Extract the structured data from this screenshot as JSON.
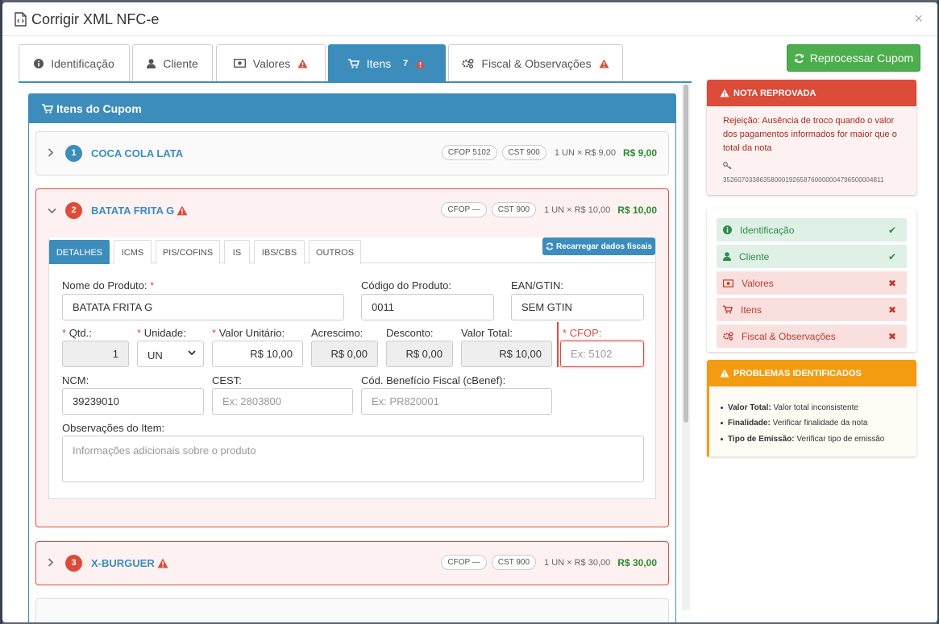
{
  "modal": {
    "title": "Corrigir XML NFC-e",
    "close": "×"
  },
  "tabs": [
    {
      "label": "Identificação",
      "icon": "info-circle-icon",
      "warning": false,
      "active": false
    },
    {
      "label": "Cliente",
      "icon": "user-icon",
      "warning": false,
      "active": false
    },
    {
      "label": "Valores",
      "icon": "money-icon",
      "warning": true,
      "active": false
    },
    {
      "label": "Itens",
      "icon": "cart-icon",
      "badge": "7",
      "warning": true,
      "active": true
    },
    {
      "label": "Fiscal & Observações",
      "icon": "cogs-icon",
      "warning": true,
      "active": false
    }
  ],
  "reprocess_button": "Reprocessar Cupom",
  "items_panel": {
    "title": "Itens do Cupom",
    "items": [
      {
        "num": "1",
        "name": "COCA COLA LATA",
        "cfop": "CFOP 5102",
        "cst": "CST 900",
        "qty": "1 UN × R$ 9,00",
        "total": "R$ 9,00",
        "error": false,
        "expanded": false
      },
      {
        "num": "2",
        "name": "BATATA FRITA G",
        "cfop": "CFOP —",
        "cst": "CST 900",
        "qty": "1 UN × R$ 10,00",
        "total": "R$ 10,00",
        "error": true,
        "expanded": true
      },
      {
        "num": "3",
        "name": "X-BURGUER",
        "cfop": "CFOP —",
        "cst": "CST 900",
        "qty": "1 UN × R$ 30,00",
        "total": "R$ 30,00",
        "error": true,
        "expanded": false
      }
    ]
  },
  "detail": {
    "tabs": [
      "DETALHES",
      "ICMS",
      "PIS/COFINS",
      "IS",
      "IBS/CBS",
      "OUTROS"
    ],
    "reload_button": "Recarregar dados fiscais",
    "fields": {
      "nome_label": "Nome do Produto:",
      "nome_value": "BATATA FRITA G",
      "codigo_label": "Código do Produto:",
      "codigo_value": "0011",
      "ean_label": "EAN/GTIN:",
      "ean_value": "SEM GTIN",
      "qtd_label": "Qtd.:",
      "qtd_value": "1",
      "unidade_label": "Unidade:",
      "unidade_value": "UN",
      "valor_unit_label": "Valor Unitário:",
      "valor_unit_value": "R$ 10,00",
      "acrescimo_label": "Acrescimo:",
      "acrescimo_value": "R$ 0,00",
      "desconto_label": "Desconto:",
      "desconto_value": "R$ 0,00",
      "valor_total_label": "Valor Total:",
      "valor_total_value": "R$ 10,00",
      "cfop_label": "CFOP:",
      "cfop_placeholder": "Ex: 5102",
      "ncm_label": "NCM:",
      "ncm_value": "39239010",
      "cest_label": "CEST:",
      "cest_placeholder": "Ex: 2803800",
      "cbenef_label": "Cód. Benefício Fiscal (cBenef):",
      "cbenef_placeholder": "Ex: PR820001",
      "obs_label": "Observações do Item:",
      "obs_placeholder": "Informações adicionais sobre o produto",
      "required_mark": "*"
    }
  },
  "nota_reprovada": {
    "title": "NOTA REPROVADA",
    "rejeicao": "Rejeição: Ausência de troco quando o valor dos pagamentos informados for maior que o total da nota",
    "chave": "35260703386358000192658760000004796500004811"
  },
  "status_list": [
    {
      "label": "Identificação",
      "ok": true,
      "icon": "info-circle-icon",
      "mark": "✔"
    },
    {
      "label": "Cliente",
      "ok": true,
      "icon": "user-icon",
      "mark": "✔"
    },
    {
      "label": "Valores",
      "ok": false,
      "icon": "money-icon",
      "mark": "✖"
    },
    {
      "label": "Itens",
      "ok": false,
      "icon": "cart-icon",
      "mark": "✖"
    },
    {
      "label": "Fiscal & Observações",
      "ok": false,
      "icon": "cogs-icon",
      "mark": "✖"
    }
  ],
  "problemas": {
    "title": "PROBLEMAS IDENTIFICADOS",
    "items": [
      {
        "field": "Valor Total:",
        "text": "Valor total inconsistente"
      },
      {
        "field": "Finalidade:",
        "text": "Verificar finalidade da nota"
      },
      {
        "field": "Tipo de Emissão:",
        "text": "Verificar tipo de emissão"
      }
    ]
  },
  "colors": {
    "primary": "#3c8dbc",
    "danger": "#dd4b39",
    "success": "#4cae4c",
    "warning": "#f39c12"
  }
}
